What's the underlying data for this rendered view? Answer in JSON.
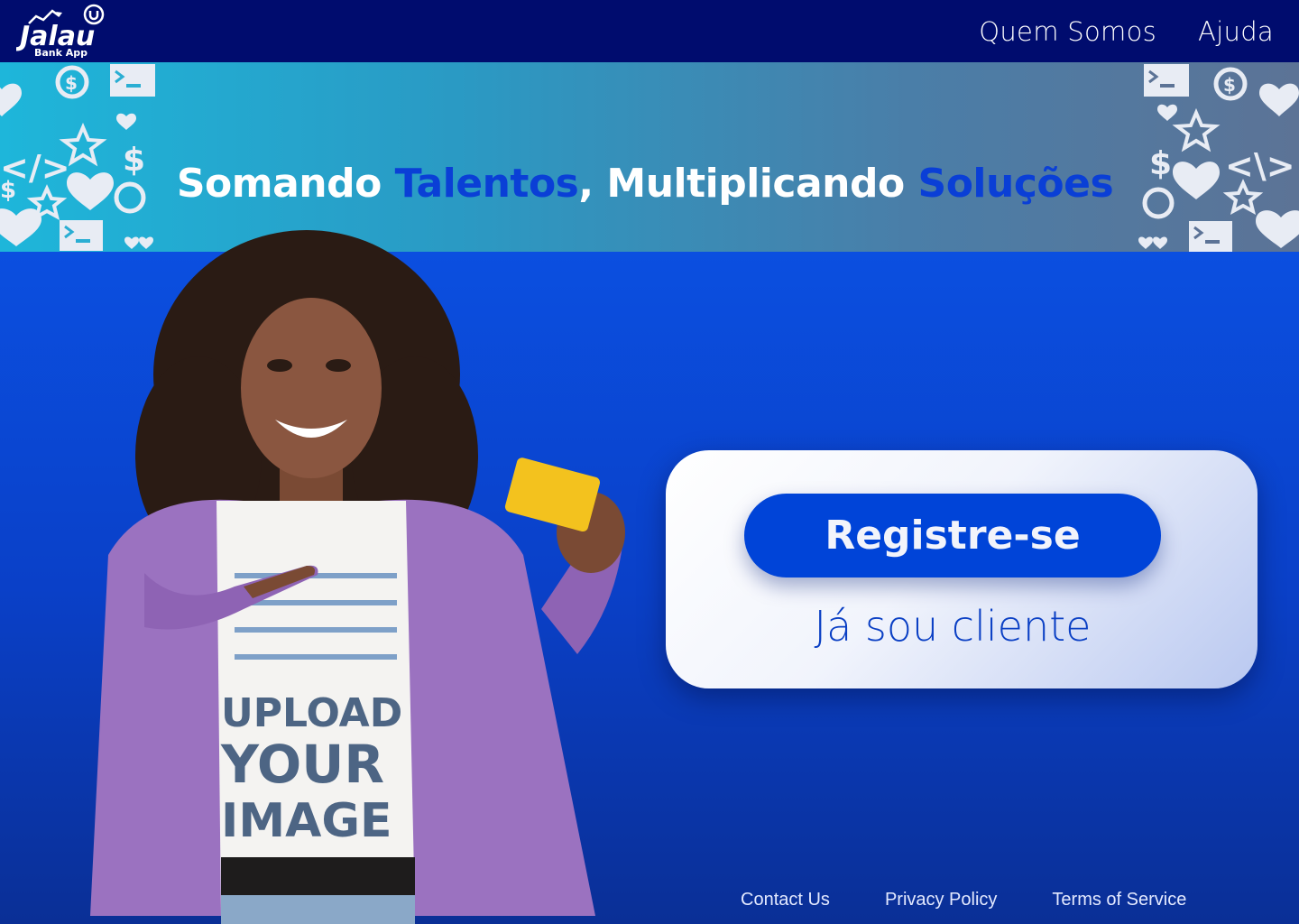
{
  "header": {
    "logo_text": "Jalau",
    "logo_sub": "Bank App",
    "nav": [
      {
        "label": "Quem Somos"
      },
      {
        "label": "Ajuda"
      }
    ]
  },
  "banner": {
    "part1": "Somando ",
    "part2": "Talentos",
    "part3": ", Multiplicando ",
    "part4": "Soluções"
  },
  "card": {
    "register_label": "Registre-se",
    "client_label": "Já sou cliente"
  },
  "photo": {
    "shirt_lines": [
      "UPLOAD",
      "YOUR",
      "IMAGE"
    ]
  },
  "footer": {
    "links": [
      {
        "label": "Contact Us"
      },
      {
        "label": "Privacy Policy"
      },
      {
        "label": "Terms of Service"
      }
    ]
  },
  "colors": {
    "topbar": "#000c6e",
    "accent": "#0044d8",
    "highlight": "#0a3fd6",
    "main_bg": "#0b4fe0"
  }
}
